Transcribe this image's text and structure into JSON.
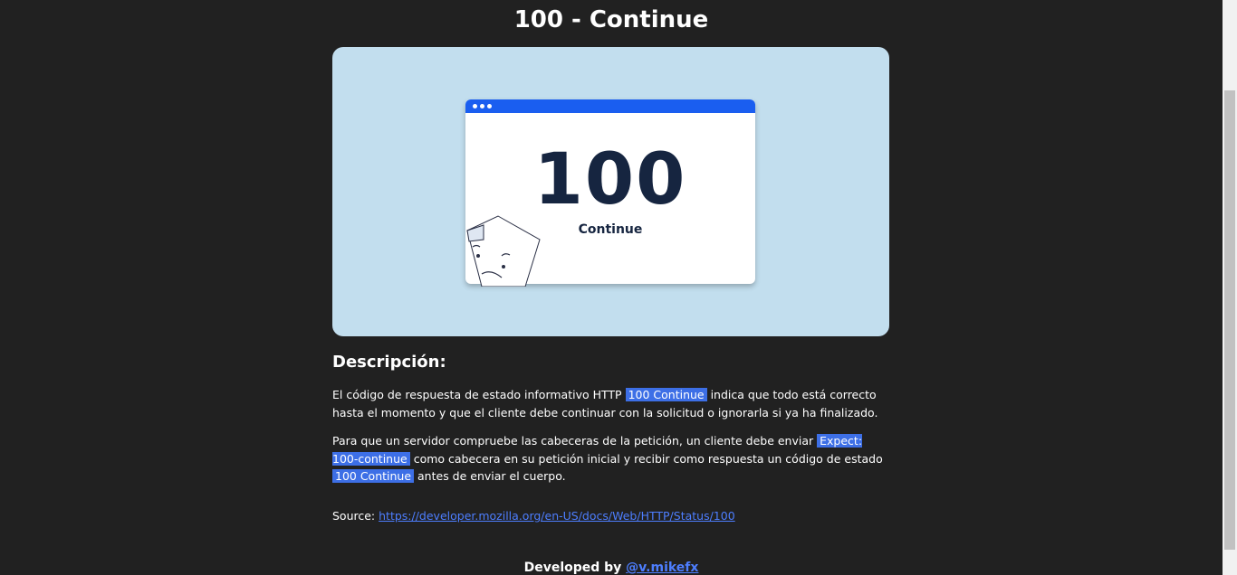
{
  "page": {
    "title": "100 - Continue"
  },
  "hero": {
    "window_dots": 3,
    "code": "100",
    "code_label": "Continue"
  },
  "description": {
    "heading": "Descripción:",
    "p1_before": "El código de respuesta de estado informativo HTTP ",
    "p1_highlight": "100 Continue",
    "p1_after": " indica que todo está correcto hasta el momento y que el cliente debe continuar con la solicitud o ignorarla si ya ha finalizado.",
    "p2_before": "Para que un servidor compruebe las cabeceras de la petición, un cliente debe enviar ",
    "p2_highlight1": "Expect: 100-continue",
    "p2_middle": " como cabecera en su petición inicial y recibir como respuesta un código de estado ",
    "p2_highlight2": "100 Continue",
    "p2_after": " antes de enviar el cuerpo."
  },
  "source": {
    "label": "Source: ",
    "url": "https://developer.mozilla.org/en-US/docs/Web/HTTP/Status/100"
  },
  "footer": {
    "prefix": "Developed by ",
    "author": "@v.mikefx"
  },
  "colors": {
    "background": "#212121",
    "hero_background": "#c2deee",
    "window_bar": "#1a5ef0",
    "highlight": "#3d6fe6",
    "link": "#4d7eff",
    "code_text": "#162540"
  }
}
